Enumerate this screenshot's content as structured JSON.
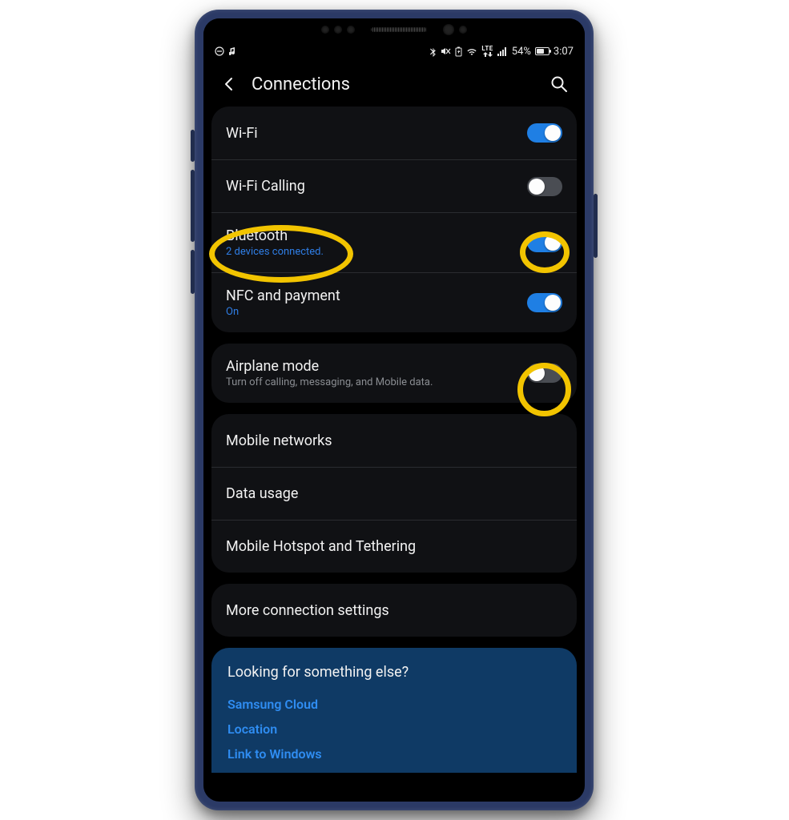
{
  "status": {
    "battery_percent": "54%",
    "time": "3:07",
    "lte": "LTE"
  },
  "header": {
    "title": "Connections"
  },
  "groups": [
    {
      "rows": [
        {
          "label": "Wi-Fi",
          "sub": "",
          "sub_accent": false,
          "toggle": "on"
        },
        {
          "label": "Wi-Fi Calling",
          "sub": "",
          "sub_accent": false,
          "toggle": "off"
        },
        {
          "label": "Bluetooth",
          "sub": "2 devices connected.",
          "sub_accent": true,
          "toggle": "on"
        },
        {
          "label": "NFC and payment",
          "sub": "On",
          "sub_accent": true,
          "toggle": "on"
        }
      ]
    },
    {
      "rows": [
        {
          "label": "Airplane mode",
          "sub": "Turn off calling, messaging, and Mobile data.",
          "sub_accent": false,
          "toggle": "off"
        }
      ]
    },
    {
      "rows": [
        {
          "label": "Mobile networks",
          "sub": "",
          "sub_accent": false,
          "toggle": null
        },
        {
          "label": "Data usage",
          "sub": "",
          "sub_accent": false,
          "toggle": null
        },
        {
          "label": "Mobile Hotspot and Tethering",
          "sub": "",
          "sub_accent": false,
          "toggle": null
        }
      ]
    },
    {
      "rows": [
        {
          "label": "More connection settings",
          "sub": "",
          "sub_accent": false,
          "toggle": null
        }
      ]
    }
  ],
  "suggest": {
    "title": "Looking for something else?",
    "links": [
      "Samsung Cloud",
      "Location",
      "Link to Windows"
    ]
  },
  "annotations": [
    {
      "name": "bluetooth-label-highlight",
      "style": "left:7px; top:148px; width:180px; height:72px; border-radius:50%/50%;"
    },
    {
      "name": "bluetooth-toggle-highlight",
      "style": "left:395px; top:156px; width:62px; height:52px;"
    },
    {
      "name": "airplane-toggle-highlight",
      "style": "left:392px; top:320px; width:67px; height:67px;"
    }
  ]
}
